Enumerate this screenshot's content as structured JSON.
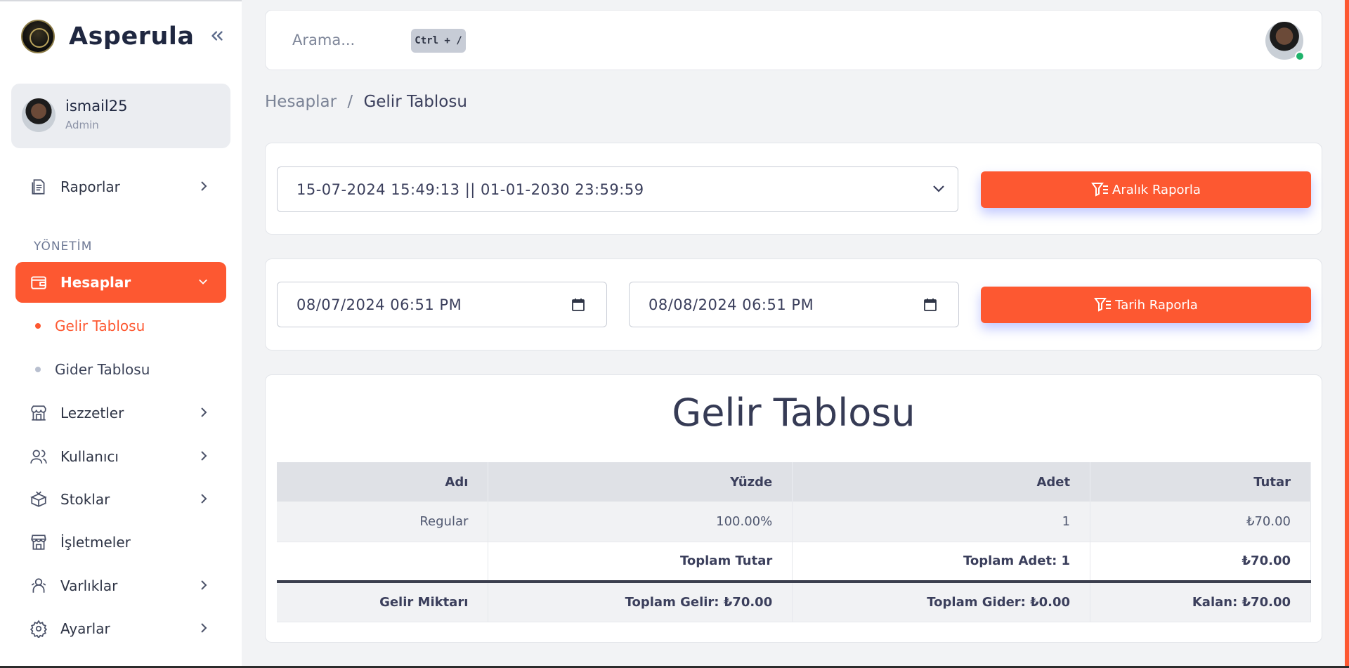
{
  "app": {
    "name": "Asperula"
  },
  "user": {
    "name": "ismail25",
    "role": "Admin"
  },
  "sidebar": {
    "section_title": "YÖNETİM",
    "items": [
      {
        "label": "Raporlar",
        "icon": "report-icon"
      },
      {
        "label": "Hesaplar",
        "icon": "wallet-icon"
      },
      {
        "label": "Lezzetler",
        "icon": "store-icon"
      },
      {
        "label": "Kullanıcı",
        "icon": "users-icon"
      },
      {
        "label": "Stoklar",
        "icon": "box-icon"
      },
      {
        "label": "İşletmeler",
        "icon": "shop-icon"
      },
      {
        "label": "Varlıklar",
        "icon": "assets-icon"
      },
      {
        "label": "Ayarlar",
        "icon": "gear-icon"
      }
    ],
    "subitems": [
      {
        "label": "Gelir Tablosu"
      },
      {
        "label": "Gider Tablosu"
      }
    ]
  },
  "topbar": {
    "search_placeholder": "Arama...",
    "shortcut": "Ctrl + /"
  },
  "breadcrumb": {
    "parent": "Hesaplar",
    "separator": "/",
    "current": "Gelir Tablosu"
  },
  "range_filter": {
    "selected": "15-07-2024 15:49:13 || 01-01-2030 23:59:59",
    "button": "Aralık Raporla"
  },
  "date_filter": {
    "start": "08/07/2024 06:51 PM",
    "end": "08/08/2024 06:51 PM",
    "button": "Tarih Raporla"
  },
  "report": {
    "title": "Gelir Tablosu",
    "headers": [
      "Adı",
      "Yüzde",
      "Adet",
      "Tutar"
    ],
    "rows": [
      {
        "name": "Regular",
        "percent": "100.00%",
        "count": "1",
        "amount": "₺70.00"
      }
    ],
    "totals": {
      "label": "Toplam Tutar",
      "count": "Toplam Adet: 1",
      "amount": "₺70.00"
    },
    "summary": {
      "label": "Gelir Miktarı",
      "income": "Toplam Gelir: ₺70.00",
      "expense": "Toplam Gider: ₺0.00",
      "remaining": "Kalan: ₺70.00"
    }
  },
  "colors": {
    "accent": "#fd5831",
    "online": "#1fb36b"
  }
}
